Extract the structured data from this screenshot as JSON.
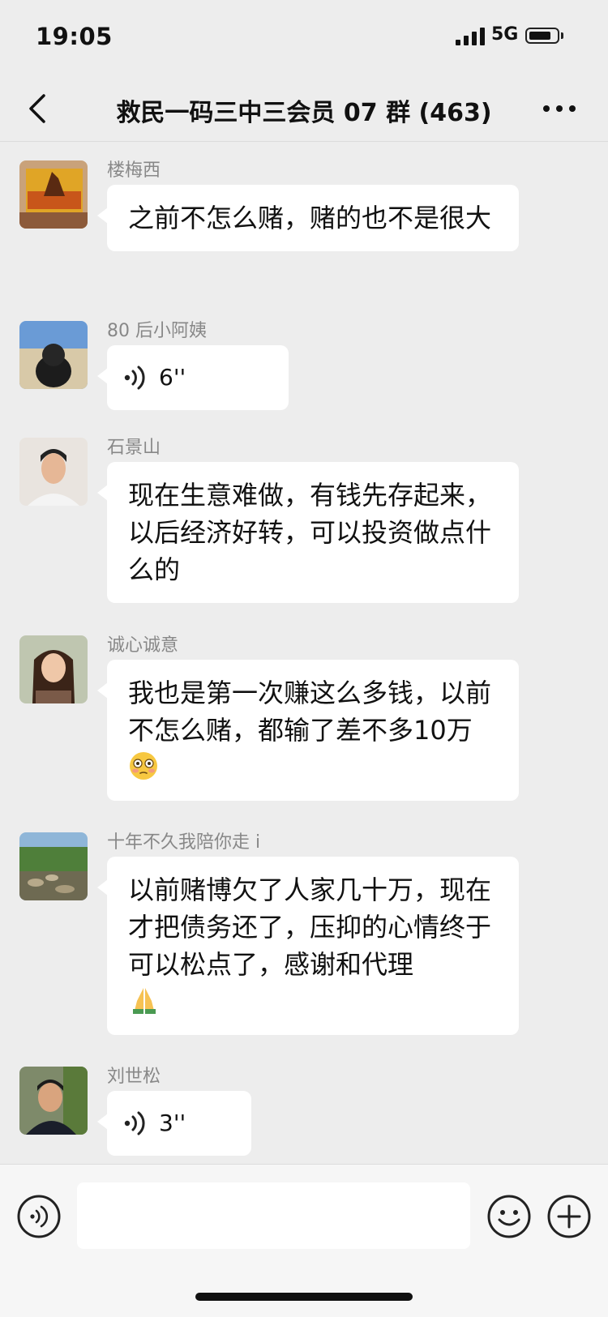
{
  "status_bar": {
    "time": "19:05",
    "network": "5G",
    "battery_level": 0.8
  },
  "nav": {
    "title": "救民一码三中三会员 07 群 (463)"
  },
  "messages": [
    {
      "sender": "楼梅西",
      "type": "text",
      "text": "之前不怎么赌，赌的也不是很大"
    },
    {
      "sender": "80 后小阿姨",
      "type": "voice",
      "duration": "6''"
    },
    {
      "sender": "石景山",
      "type": "text",
      "text": "现在生意难做，有钱先存起来，以后经济好转，可以投资做点什么的"
    },
    {
      "sender": "诚心诚意",
      "type": "text",
      "text": "我也是第一次赚这么多钱，以前不怎么赌，都输了差不多10万",
      "emoji": "flushed-face-emoji"
    },
    {
      "sender": "十年不久我陪你走 i",
      "type": "text",
      "text": "以前赌博欠了人家几十万，现在才把债务还了，压抑的心情终于可以松点了，感谢和代理",
      "emoji": "folded-hands-emoji"
    },
    {
      "sender": "刘世松",
      "type": "voice",
      "duration": "3''"
    }
  ],
  "input_bar": {
    "placeholder": ""
  }
}
